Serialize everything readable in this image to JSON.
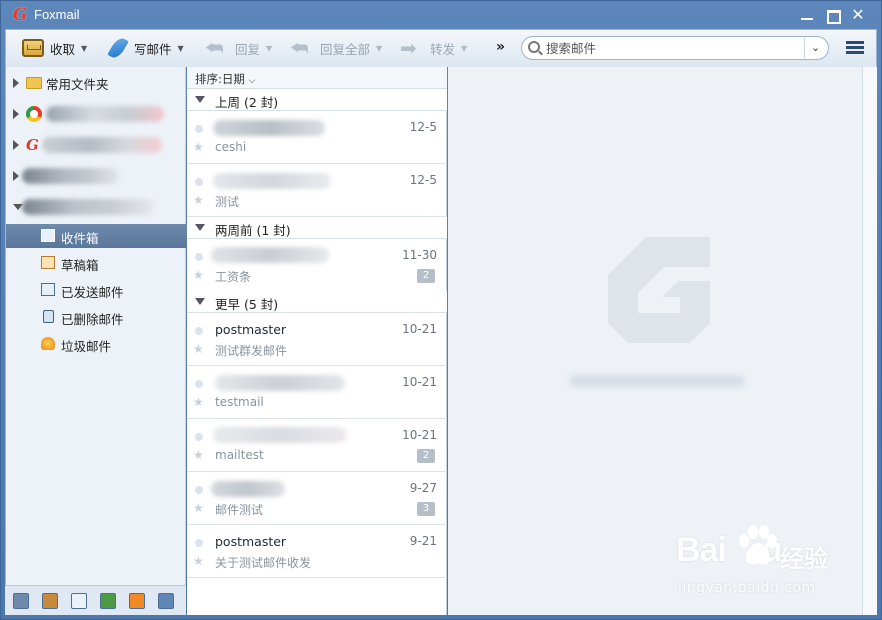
{
  "window": {
    "title": "Foxmail",
    "minimize": "—",
    "maximize": "□",
    "close": "✕"
  },
  "toolbar": {
    "receive": "收取",
    "compose": "写邮件",
    "reply": "回复",
    "reply_all": "回复全部",
    "forward": "转发",
    "more": "»",
    "search_placeholder": "搜索邮件",
    "search_dropdown": "⌄"
  },
  "sidebar": {
    "common_folder": "常用文件夹",
    "items": [
      {
        "label": "收件箱",
        "selected": true,
        "icon": "inbox-icon"
      },
      {
        "label": "草稿箱",
        "selected": false,
        "icon": "drafts-icon"
      },
      {
        "label": "已发送邮件",
        "selected": false,
        "icon": "sent-icon"
      },
      {
        "label": "已删除邮件",
        "selected": false,
        "icon": "trash-icon"
      },
      {
        "label": "垃圾邮件",
        "selected": false,
        "icon": "junk-icon"
      }
    ],
    "bottom_icons": [
      "mail-icon",
      "contacts-icon",
      "calendar-icon",
      "notes-icon",
      "rss-icon",
      "apps-icon"
    ]
  },
  "list": {
    "sort_label": "排序:日期",
    "groups": [
      {
        "label": "上周 (2 封)",
        "messages": [
          {
            "sender": "",
            "date": "12-5",
            "subject": "ceshi",
            "count": ""
          },
          {
            "sender": "",
            "date": "12-5",
            "subject": "测试",
            "count": ""
          }
        ]
      },
      {
        "label": "两周前 (1 封)",
        "messages": [
          {
            "sender": "",
            "date": "11-30",
            "subject": "工资条",
            "count": "2"
          }
        ]
      },
      {
        "label": "更早 (5 封)",
        "messages": [
          {
            "sender": "postmaster",
            "date": "10-21",
            "subject": "测试群发邮件",
            "count": ""
          },
          {
            "sender": "",
            "date": "10-21",
            "subject": "testmail",
            "count": ""
          },
          {
            "sender": "",
            "date": "10-21",
            "subject": "mailtest",
            "count": "2"
          },
          {
            "sender": "",
            "date": "9-27",
            "subject": "邮件测试",
            "count": "3"
          },
          {
            "sender": "postmaster",
            "date": "9-21",
            "subject": "关于测试邮件收发",
            "count": ""
          }
        ]
      }
    ]
  },
  "watermark": {
    "brand": "Bai",
    "brand_end": "u",
    "cn": "经验",
    "url": "jingyan.baidu.com"
  },
  "colors": {
    "accent": "#5a7699",
    "title_bar": "#5d87bb",
    "logo_red": "#e03a2a"
  }
}
